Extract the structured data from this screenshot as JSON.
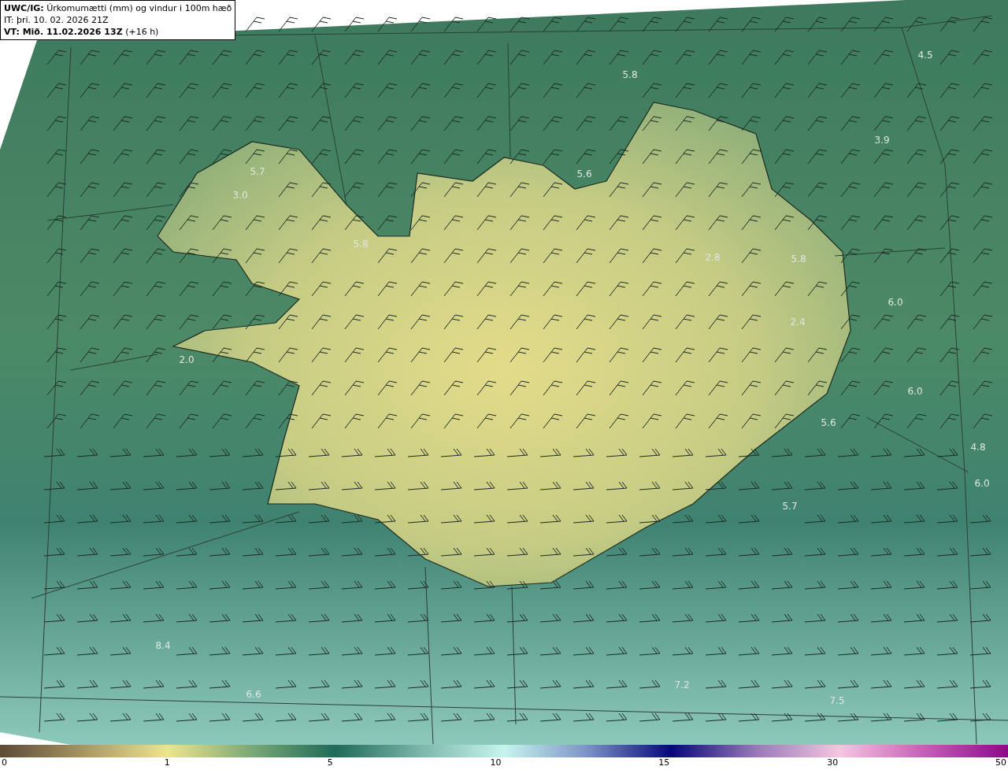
{
  "title_box": {
    "model": "UWC/IG:",
    "title": "Úrkomumætti (mm) og vindur i 100m hæð",
    "issued": "IT: þri. 10. 02. 2026 21Z",
    "valid": "VT: Mið. 11.02.2026 13Z",
    "lead": "(+16 h)"
  },
  "map_values": [
    "5.8",
    "4.5",
    "3.9",
    "5.7",
    "3.0",
    "5.6",
    "5.8",
    "2.8",
    "5.8",
    "6.0",
    "2.4",
    "2.0",
    "6.0",
    "5.6",
    "4.8",
    "6.0",
    "5.7",
    "8.4",
    "6.6",
    "7.2",
    "7.5"
  ],
  "colorbar": {
    "ticks": [
      "0",
      "1",
      "5",
      "10",
      "15",
      "30",
      "50"
    ]
  }
}
